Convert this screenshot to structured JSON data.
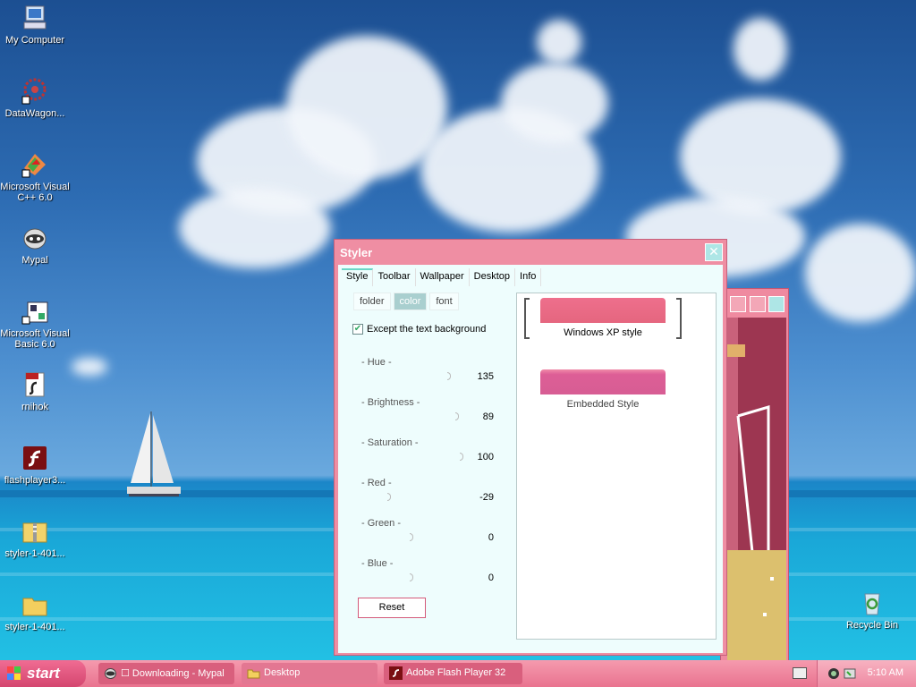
{
  "desktop_icons": [
    {
      "label": "My Computer",
      "icon": "my-computer-icon"
    },
    {
      "label": "DataWagon...",
      "icon": "datawagon-icon"
    },
    {
      "label": "Microsoft Visual C++ 6.0",
      "icon": "visual-cpp-icon"
    },
    {
      "label": "Mypal",
      "icon": "mypal-icon"
    },
    {
      "label": "Microsoft Visual Basic 6.0",
      "icon": "visual-basic-icon"
    },
    {
      "label": "rnihok",
      "icon": "swf-file-icon"
    },
    {
      "label": "flashplayer3...",
      "icon": "flash-player-icon"
    },
    {
      "label": "styler-1-401...",
      "icon": "zip-folder-icon"
    },
    {
      "label": "styler-1-401...",
      "icon": "folder-icon"
    },
    {
      "label": "Recycle Bin",
      "icon": "recycle-bin-icon"
    }
  ],
  "styler": {
    "title": "Styler",
    "close_glyph": "✕",
    "tabs": [
      {
        "label": "Style",
        "active": true
      },
      {
        "label": "Toolbar",
        "active": false
      },
      {
        "label": "Wallpaper",
        "active": false
      },
      {
        "label": "Desktop",
        "active": false
      },
      {
        "label": "Info",
        "active": false
      }
    ],
    "subtabs": [
      {
        "label": "folder",
        "active": false
      },
      {
        "label": "color",
        "active": true
      },
      {
        "label": "font",
        "active": false
      }
    ],
    "checkbox": {
      "label": "Except the text background",
      "checked": true
    },
    "sliders": [
      {
        "label": "- Hue -",
        "value": "135"
      },
      {
        "label": "- Brightness -",
        "value": "89"
      },
      {
        "label": "- Saturation -",
        "value": "100"
      },
      {
        "label": "- Red -",
        "value": "-29"
      },
      {
        "label": "- Green -",
        "value": "0"
      },
      {
        "label": "- Blue -",
        "value": "0"
      }
    ],
    "reset_label": "Reset",
    "styles": [
      {
        "label": "Windows XP style",
        "selected": true
      },
      {
        "label": "Embedded Style",
        "selected": false
      }
    ]
  },
  "taskbar": {
    "start_label": "start",
    "tasks": [
      {
        "label": "☐ Downloading - Mypal",
        "icon": "mypal-icon"
      },
      {
        "label": "Desktop",
        "icon": "folder-icon"
      },
      {
        "label": "Adobe Flash Player 32",
        "icon": "flash-player-icon"
      }
    ],
    "clock": "5:10 AM"
  },
  "colors": {
    "accent_pink": "#ef8ea3",
    "panel_bg": "#eefdfd",
    "taskbar_pink": "#e9738f",
    "style_swatch": "#ea6f8c"
  }
}
